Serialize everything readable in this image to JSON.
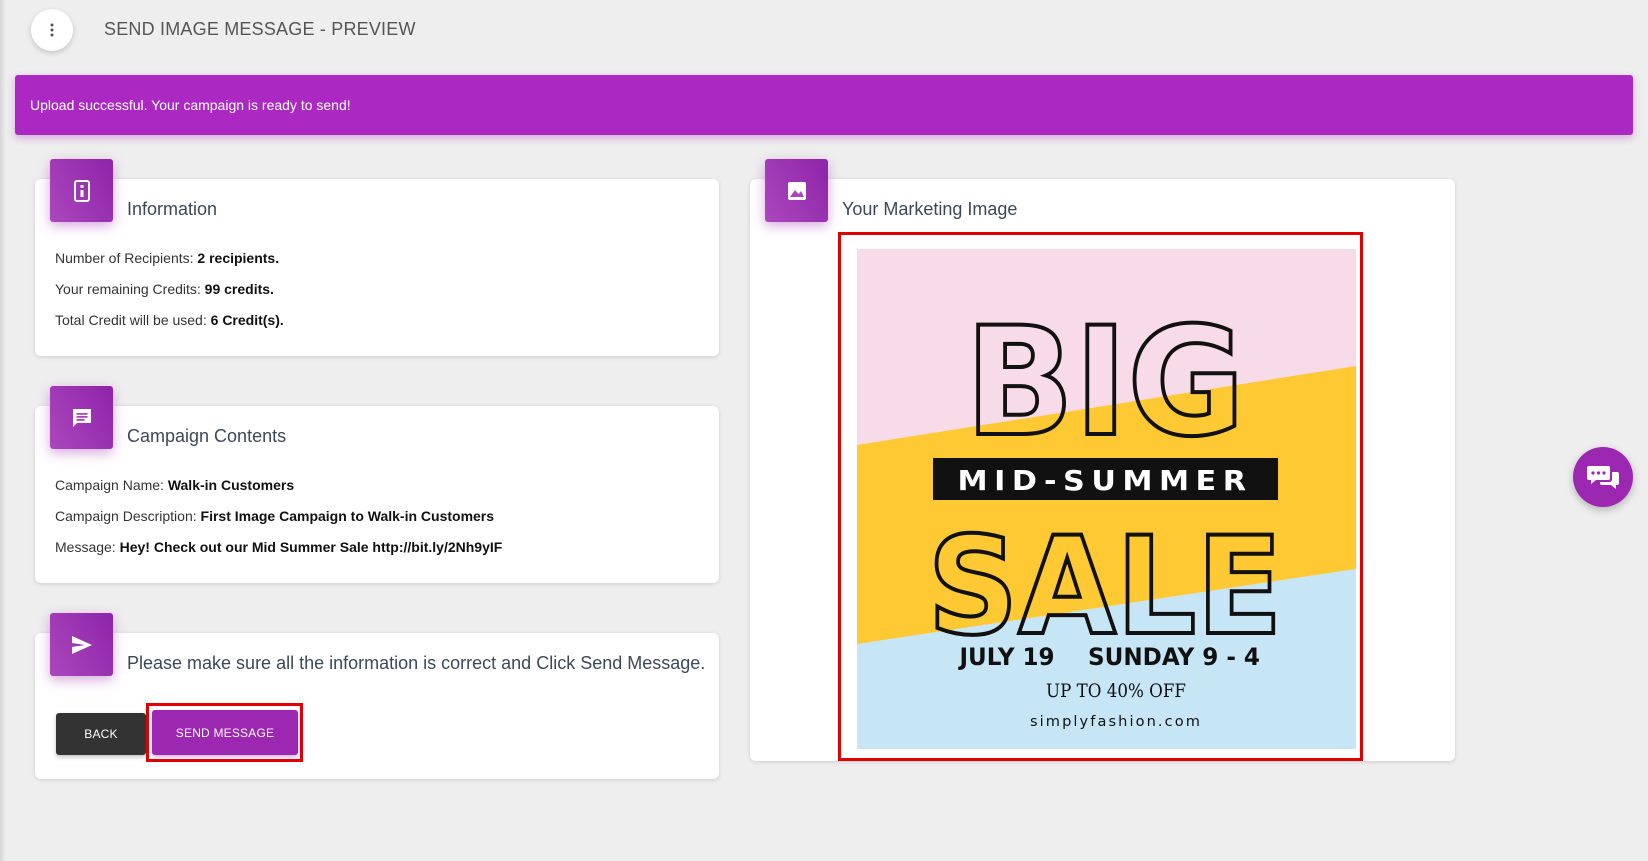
{
  "header": {
    "title": "SEND IMAGE MESSAGE - PREVIEW",
    "menu_icon": "more-vert-icon"
  },
  "alert": {
    "message": "Upload successful. Your campaign is ready to send!",
    "color": "#ab29c2"
  },
  "information": {
    "title": "Information",
    "icon": "phone-icon",
    "recipients_label": "Number of Recipients: ",
    "recipients_value": "2 recipients.",
    "credits_label": "Your remaining Credits: ",
    "credits_value": "99 credits.",
    "used_label": "Total Credit will be used: ",
    "used_value": "6 Credit(s)."
  },
  "campaign": {
    "title": "Campaign Contents",
    "icon": "message-icon",
    "name_label": "Campaign Name: ",
    "name_value": "Walk-in Customers",
    "desc_label": "Campaign Description: ",
    "desc_value": "First Image Campaign to Walk-in Customers",
    "message_label": "Message: ",
    "message_value": "Hey! Check out our Mid Summer Sale http://bit.ly/2Nh9yIF"
  },
  "confirm": {
    "title": "Please make sure all the information is correct and Click Send Message.",
    "icon": "send-icon",
    "back_label": "BACK",
    "send_label": "SEND MESSAGE"
  },
  "image_card": {
    "title": "Your Marketing Image",
    "icon": "image-icon",
    "promo": {
      "big": "BIG",
      "mid": "MID-SUMMER",
      "sale": "SALE",
      "date": "JULY 19",
      "time": "SUNDAY 9 - 4",
      "offer": "UP TO 40% OFF",
      "site": "simplyfashion.com"
    }
  },
  "chat": {
    "icon": "chat-bubbles-icon"
  },
  "colors": {
    "accent": "#9c27b0",
    "highlight": "#e00000",
    "promo_pink": "#f8dbe8",
    "promo_yellow": "#fec932",
    "promo_blue": "#c6e6f5"
  }
}
